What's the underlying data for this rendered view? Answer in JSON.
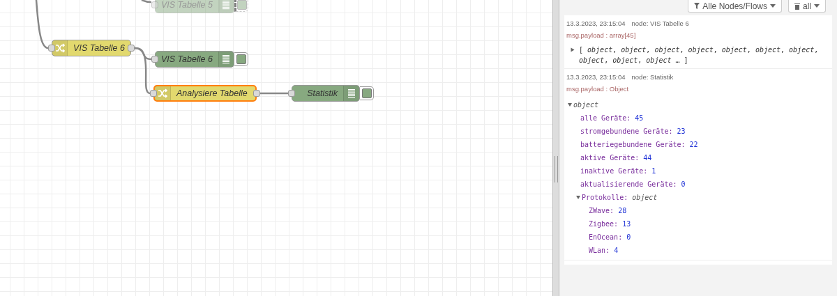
{
  "canvas": {
    "nodes": [
      {
        "label": "VIS Tabelle 5",
        "kind": "debug",
        "selected": false,
        "disabled": true
      },
      {
        "label": "VIS Tabelle 6",
        "kind": "switch",
        "selected": false,
        "disabled": false
      },
      {
        "label": "VIS Tabelle 6",
        "kind": "debug",
        "selected": false,
        "disabled": false
      },
      {
        "label": "Analysiere Tabelle",
        "kind": "switch",
        "selected": true,
        "disabled": false
      },
      {
        "label": "Statistik",
        "kind": "debug",
        "selected": false,
        "disabled": false
      }
    ]
  },
  "sidebar": {
    "filter": "Alle Nodes/Flows",
    "clear": "all",
    "messages": [
      {
        "time": "13.3.2023, 23:15:04",
        "node": "node: VIS Tabelle 6",
        "path": "msg.payload : array[45]",
        "kind": "array",
        "expanded": false,
        "preview": "[ *object*, *object*, *object*, *object*, *object*, *object*, *object*, *object*, *object*, *object* … ]"
      },
      {
        "time": "13.3.2023, 23:15:04",
        "node": "node: Statistik",
        "path": "msg.payload : Object",
        "kind": "object",
        "tree": {
          "label": "object",
          "expanded": true,
          "children": [
            {
              "key": "alle Geräte:",
              "value": "45"
            },
            {
              "key": "stromgebundene Geräte:",
              "value": "23"
            },
            {
              "key": "batteriegebundene Geräte:",
              "value": "22"
            },
            {
              "key": "aktive Geräte:",
              "value": "44"
            },
            {
              "key": "inaktive Geräte:",
              "value": "1"
            },
            {
              "key": "aktualisierende Geräte:",
              "value": "0"
            },
            {
              "key": "Protokolle:",
              "label": "object",
              "expanded": true,
              "children": [
                {
                  "key": "ZWave:",
                  "value": "28"
                },
                {
                  "key": "Zigbee:",
                  "value": "13"
                },
                {
                  "key": "EnOcean:",
                  "value": "0"
                },
                {
                  "key": "WLan:",
                  "value": "4"
                }
              ]
            }
          ]
        }
      }
    ]
  }
}
